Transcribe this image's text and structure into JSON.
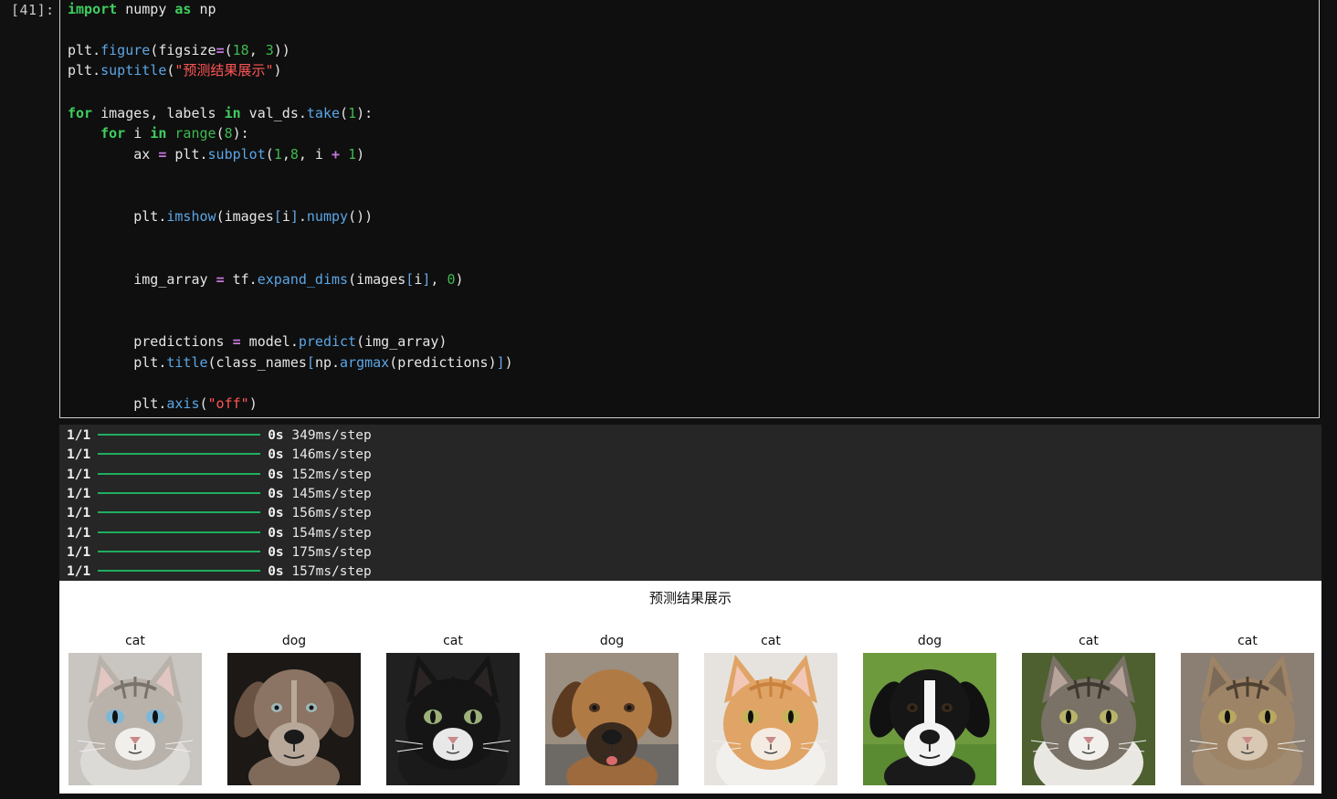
{
  "cell": {
    "prompt": "[41]:"
  },
  "code_lines": [
    {
      "tokens": [
        [
          "kw",
          "import"
        ],
        [
          "t",
          " numpy "
        ],
        [
          "kw",
          "as"
        ],
        [
          "t",
          " np"
        ]
      ]
    },
    {
      "tokens": [
        [
          "t",
          "plt."
        ],
        [
          "fn",
          "figure"
        ],
        [
          "t",
          "(figsize"
        ],
        [
          "op",
          "="
        ],
        [
          "t",
          "("
        ],
        [
          "num",
          "18"
        ],
        [
          "t",
          ", "
        ],
        [
          "num",
          "3"
        ],
        [
          "t",
          "))"
        ]
      ]
    },
    {
      "tokens": [
        [
          "t",
          "plt."
        ],
        [
          "fn",
          "suptitle"
        ],
        [
          "t",
          "("
        ],
        [
          "str",
          "\"预测结果展示\""
        ],
        [
          "t",
          ")"
        ]
      ]
    },
    {
      "tokens": [
        [
          "kw",
          "for"
        ],
        [
          "t",
          " images, labels "
        ],
        [
          "kw",
          "in"
        ],
        [
          "t",
          " val_ds."
        ],
        [
          "fn",
          "take"
        ],
        [
          "t",
          "("
        ],
        [
          "num",
          "1"
        ],
        [
          "t",
          "):"
        ]
      ]
    },
    {
      "tokens": [
        [
          "t",
          "    "
        ],
        [
          "kw",
          "for"
        ],
        [
          "t",
          " i "
        ],
        [
          "kw",
          "in"
        ],
        [
          "t",
          " "
        ],
        [
          "bi",
          "range"
        ],
        [
          "t",
          "("
        ],
        [
          "num",
          "8"
        ],
        [
          "t",
          "):"
        ]
      ]
    },
    {
      "tokens": [
        [
          "t",
          "        ax "
        ],
        [
          "op",
          "="
        ],
        [
          "t",
          " plt."
        ],
        [
          "fn",
          "subplot"
        ],
        [
          "t",
          "("
        ],
        [
          "num",
          "1"
        ],
        [
          "t",
          ","
        ],
        [
          "num",
          "8"
        ],
        [
          "t",
          ", i "
        ],
        [
          "op",
          "+"
        ],
        [
          "t",
          " "
        ],
        [
          "num",
          "1"
        ],
        [
          "t",
          ")"
        ]
      ]
    },
    {
      "tokens": [
        [
          "t",
          "        plt."
        ],
        [
          "fn",
          "imshow"
        ],
        [
          "t",
          "(images"
        ],
        [
          "br",
          "["
        ],
        [
          "t",
          "i"
        ],
        [
          "br",
          "]"
        ],
        [
          "t",
          "."
        ],
        [
          "fn",
          "numpy"
        ],
        [
          "t",
          "())"
        ]
      ]
    },
    {
      "tokens": [
        [
          "t",
          "        img_array "
        ],
        [
          "op",
          "="
        ],
        [
          "t",
          " tf."
        ],
        [
          "fn",
          "expand_dims"
        ],
        [
          "t",
          "(images"
        ],
        [
          "br",
          "["
        ],
        [
          "t",
          "i"
        ],
        [
          "br",
          "]"
        ],
        [
          "t",
          ", "
        ],
        [
          "num",
          "0"
        ],
        [
          "t",
          ")"
        ]
      ]
    },
    {
      "tokens": [
        [
          "t",
          "        predictions "
        ],
        [
          "op",
          "="
        ],
        [
          "t",
          " model."
        ],
        [
          "fn",
          "predict"
        ],
        [
          "t",
          "(img_array)"
        ]
      ]
    },
    {
      "tokens": [
        [
          "t",
          "        plt."
        ],
        [
          "fn",
          "title"
        ],
        [
          "t",
          "(class_names"
        ],
        [
          "br",
          "["
        ],
        [
          "t",
          "np."
        ],
        [
          "fn",
          "argmax"
        ],
        [
          "t",
          "(predictions)"
        ],
        [
          "br",
          "]"
        ],
        [
          "t",
          ")"
        ]
      ]
    },
    {
      "tokens": [
        [
          "t",
          "        plt."
        ],
        [
          "fn",
          "axis"
        ],
        [
          "t",
          "("
        ],
        [
          "str",
          "\"off\""
        ],
        [
          "t",
          ")"
        ]
      ]
    }
  ],
  "output_lines": [
    {
      "step": "1/1",
      "time": "0s",
      "rate": "349ms/step"
    },
    {
      "step": "1/1",
      "time": "0s",
      "rate": "146ms/step"
    },
    {
      "step": "1/1",
      "time": "0s",
      "rate": "152ms/step"
    },
    {
      "step": "1/1",
      "time": "0s",
      "rate": "145ms/step"
    },
    {
      "step": "1/1",
      "time": "0s",
      "rate": "156ms/step"
    },
    {
      "step": "1/1",
      "time": "0s",
      "rate": "154ms/step"
    },
    {
      "step": "1/1",
      "time": "0s",
      "rate": "175ms/step"
    },
    {
      "step": "1/1",
      "time": "0s",
      "rate": "157ms/step"
    }
  ],
  "figure": {
    "suptitle": "预测结果展示",
    "subplots": [
      {
        "label": "cat",
        "image": "grey-tabby-cat-photo"
      },
      {
        "label": "dog",
        "image": "merle-dog-photo"
      },
      {
        "label": "cat",
        "image": "black-kitten-photo"
      },
      {
        "label": "dog",
        "image": "shepherd-dog-photo"
      },
      {
        "label": "cat",
        "image": "orange-kitten-photo"
      },
      {
        "label": "dog",
        "image": "black-white-dog-photo"
      },
      {
        "label": "cat",
        "image": "tabby-white-cat-photo"
      },
      {
        "label": "cat",
        "image": "tabby-cat-photo"
      }
    ]
  },
  "colors": {
    "keyword": "#3fcf5e",
    "function": "#5aa6e6",
    "string": "#ff5555",
    "progress_bar": "#1fae5f",
    "output_bg": "#262626",
    "figure_bg": "#ffffff"
  }
}
